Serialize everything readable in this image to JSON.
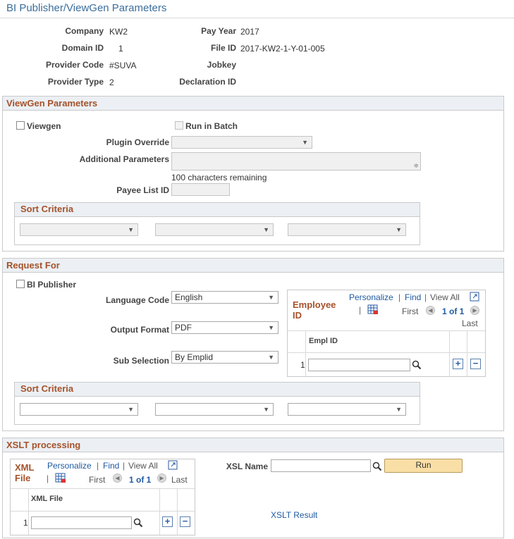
{
  "page_title": "BI Publisher/ViewGen Parameters",
  "header_fields": {
    "company_label": "Company",
    "company_value": "KW2",
    "pay_year_label": "Pay Year",
    "pay_year_value": "2017",
    "domain_id_label": "Domain ID",
    "domain_id_value": "1",
    "file_id_label": "File ID",
    "file_id_value": "2017-KW2-1-Y-01-005",
    "provider_code_label": "Provider Code",
    "provider_code_value": "#SUVA",
    "jobkey_label": "Jobkey",
    "jobkey_value": "",
    "provider_type_label": "Provider Type",
    "provider_type_value": "2",
    "declaration_id_label": "Declaration ID",
    "declaration_id_value": ""
  },
  "viewgen": {
    "title": "ViewGen Parameters",
    "viewgen_label": "Viewgen",
    "run_in_batch_label": "Run in Batch",
    "plugin_override_label": "Plugin Override",
    "plugin_override_value": "",
    "additional_parameters_label": "Additional Parameters",
    "additional_parameters_value": "",
    "chars_remaining": "100 characters remaining",
    "payee_list_id_label": "Payee List ID",
    "payee_list_id_value": "",
    "sort_criteria_title": "Sort Criteria",
    "sort_values": [
      "",
      "",
      ""
    ]
  },
  "request_for": {
    "title": "Request For",
    "bi_publisher_label": "BI Publisher",
    "language_code_label": "Language Code",
    "language_code_value": "English",
    "output_format_label": "Output Format",
    "output_format_value": "PDF",
    "sub_selection_label": "Sub Selection",
    "sub_selection_value": "By Emplid",
    "sort_criteria_title": "Sort Criteria",
    "sort_values": [
      "",
      "",
      ""
    ]
  },
  "employee_grid": {
    "title": "Employee ID",
    "personalize": "Personalize",
    "find": "Find",
    "view_all": "View All",
    "first": "First",
    "counter": "1 of 1",
    "last": "Last",
    "column_header": "Empl ID",
    "rows": [
      {
        "num": "1",
        "value": ""
      }
    ]
  },
  "xslt": {
    "title": "XSLT processing",
    "xsl_name_label": "XSL Name",
    "xsl_name_value": "",
    "run_label": "Run",
    "result_link": "XSLT Result"
  },
  "xml_grid": {
    "title": "XML File",
    "personalize": "Personalize",
    "find": "Find",
    "view_all": "View All",
    "first": "First",
    "counter": "1 of 1",
    "last": "Last",
    "column_header": "XML File",
    "rows": [
      {
        "num": "1",
        "value": ""
      }
    ]
  },
  "icons": {
    "checkbox": "checkbox",
    "dropdown": "chevron-down-icon",
    "lookup": "magnifier-icon",
    "grid_download": "spreadsheet-icon",
    "new_window": "new-window-icon",
    "prev": "prev-arrow-icon",
    "next": "next-arrow-icon",
    "add_row": "plus-icon",
    "delete_row": "minus-icon"
  },
  "colors": {
    "section_title": "#a5522a",
    "link": "#1f5aa0",
    "page_title": "#3b6e9d",
    "run_button": "#f9dfa5"
  }
}
